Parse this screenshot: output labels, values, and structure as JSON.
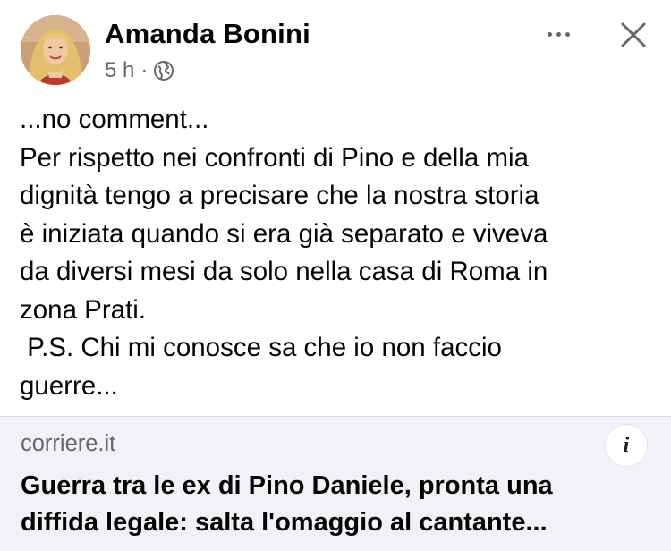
{
  "post": {
    "author": {
      "name": "Amanda Bonini",
      "avatar_icon": "profile-photo"
    },
    "meta": {
      "time": "5 h",
      "separator": "·",
      "audience_icon": "globe-icon"
    },
    "actions": {
      "more_icon": "more-horizontal-icon",
      "close_icon": "close-icon"
    },
    "text_lines": [
      "...no comment...",
      "Per rispetto nei confronti di Pino e della mia",
      "dignità tengo a precisare che la nostra storia",
      "è iniziata quando si era già separato e viveva",
      "da diversi mesi da solo nella casa di Roma in",
      "zona Prati.",
      " P.S. Chi mi conosce sa che io non faccio",
      "guerre..."
    ]
  },
  "link_preview": {
    "domain": "corriere.it",
    "info_label": "i",
    "title_lines": [
      "Guerra tra le ex di Pino Daniele, pronta una",
      "diffida legale: salta l'omaggio al cantante..."
    ]
  },
  "colors": {
    "text_primary": "#050505",
    "text_secondary": "#65676b",
    "preview_background": "#f0f2f5"
  }
}
